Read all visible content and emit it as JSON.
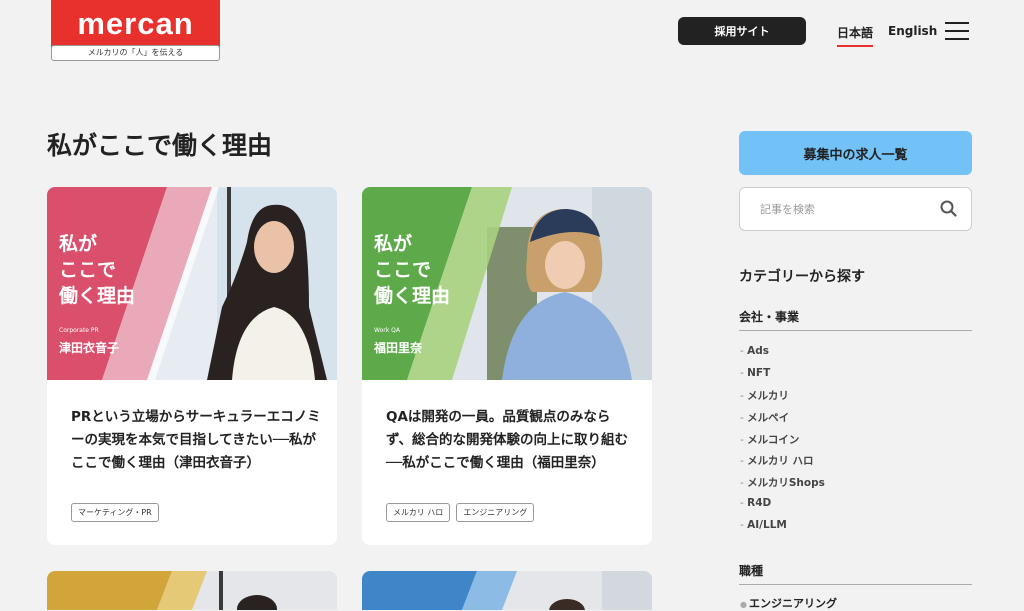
{
  "header": {
    "logo_wordmark": "mercan",
    "logo_tagline": "メルカリの「人」を伝える",
    "recruit_button": "採用サイト",
    "lang_ja": "日本語",
    "lang_en": "English"
  },
  "main": {
    "title": "私がここで働く理由",
    "cards": [
      {
        "overlay_lines": [
          "私が",
          "ここで",
          "働く理由"
        ],
        "role": "Corporate PR",
        "name": "津田衣音子",
        "title": "PRという立場からサーキュラーエコノミーの実現を本気で目指してきたい──私がここで働く理由（津田衣音子）",
        "tags": [
          "マーケティング・PR"
        ]
      },
      {
        "overlay_lines": [
          "私が",
          "ここで",
          "働く理由"
        ],
        "role": "Work QA",
        "name": "福田里奈",
        "title": "QAは開発の一員。品質観点のみならず、総合的な開発体験の向上に取り組む──私がここで働く理由（福田里奈）",
        "tags": [
          "メルカリ ハロ",
          "エンジニアリング"
        ]
      }
    ]
  },
  "sidebar": {
    "jobs_button": "募集中の求人一覧",
    "search_placeholder": "記事を検索",
    "category_heading": "カテゴリーから探す",
    "section_company": "会社・事業",
    "categories": [
      "Ads",
      "NFT",
      "メルカリ",
      "メルペイ",
      "メルコイン",
      "メルカリ ハロ",
      "メルカリShops",
      "R4D",
      "AI/LLM"
    ],
    "section_job": "職種",
    "job_first": "エンジニアリング"
  },
  "colors": {
    "brand_red": "#e8302c",
    "jobs_blue": "#72c1f7",
    "card1_accent": "#d94f6c",
    "card2_accent": "#5eaa4a"
  },
  "icons": [
    "hamburger-menu-icon",
    "search-icon"
  ]
}
